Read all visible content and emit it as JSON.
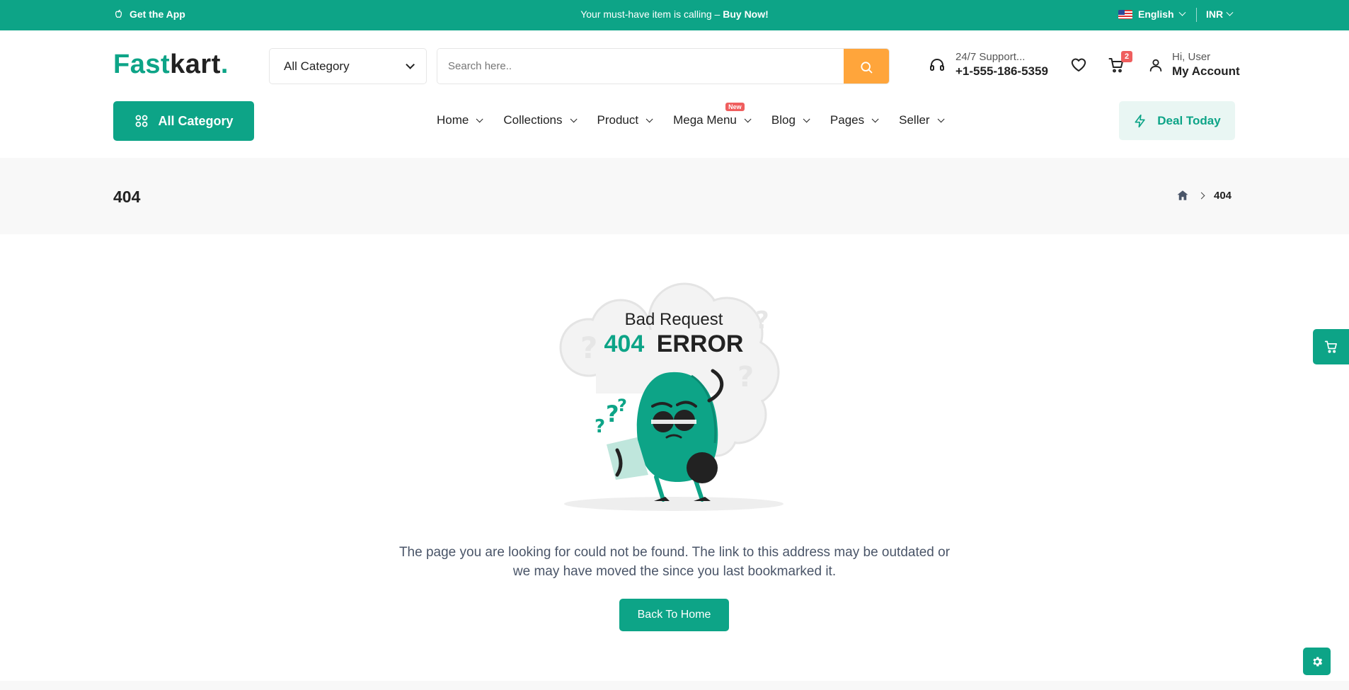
{
  "topbar": {
    "app_label": "Get the App",
    "promo_text": "Your must-have item is calling – ",
    "promo_cta": "Buy Now!",
    "language": "English",
    "currency": "INR"
  },
  "header": {
    "logo_part1": "Fast",
    "logo_part2": "kart",
    "logo_dot": ".",
    "category_select": "All Category",
    "search_placeholder": "Search here..",
    "support_label": "24/7 Support...",
    "support_phone": "+1-555-186-5359",
    "cart_count": "2",
    "greeting": "Hi, User",
    "account_label": "My Account"
  },
  "nav": {
    "all_category": "All Category",
    "items": [
      {
        "label": "Home"
      },
      {
        "label": "Collections"
      },
      {
        "label": "Product"
      },
      {
        "label": "Mega Menu",
        "badge": "New"
      },
      {
        "label": "Blog"
      },
      {
        "label": "Pages"
      },
      {
        "label": "Seller"
      }
    ],
    "deal": "Deal Today"
  },
  "breadcrumb": {
    "title": "404",
    "current": "404"
  },
  "error": {
    "heading": "Bad Request",
    "code": "404",
    "code_word": "ERROR",
    "message": "The page you are looking for could not be found. The link to this address may be outdated or we may have moved the since you last bookmarked it.",
    "button": "Back To Home"
  },
  "colors": {
    "brand": "#0da487",
    "search_button": "#ffa53b",
    "badge": "#ef5e5e"
  },
  "icons": {
    "apple": "apple-icon",
    "headset": "headset-icon",
    "wishlist": "heart-icon",
    "cart": "cart-icon",
    "user": "user-icon",
    "grid": "grid-icon",
    "bolt": "bolt-icon",
    "home": "home-icon",
    "search": "search-icon",
    "settings": "gear-icon"
  }
}
